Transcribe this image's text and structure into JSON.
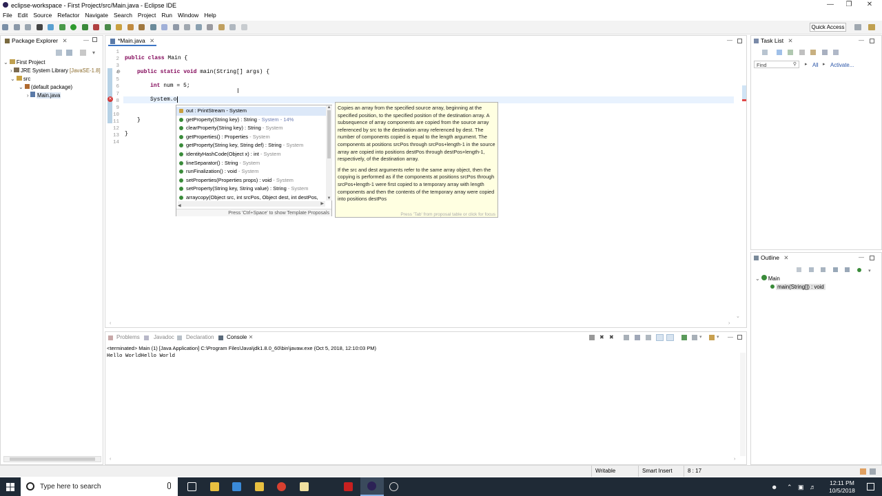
{
  "window": {
    "title": "eclipse-workspace - First Project/src/Main.java - Eclipse IDE"
  },
  "menu": [
    "File",
    "Edit",
    "Source",
    "Refactor",
    "Navigate",
    "Search",
    "Project",
    "Run",
    "Window",
    "Help"
  ],
  "quick_access": "Quick Access",
  "package_explorer": {
    "title": "Package Explorer",
    "tree": [
      "First Project",
      "JRE System Library",
      "[JavaSE-1.8]",
      "src",
      "(default package)",
      "Main.java"
    ]
  },
  "editor": {
    "tab": "*Main.java",
    "line_numbers": [
      "1",
      "2",
      "3",
      "4",
      "5",
      "6",
      "7",
      "8",
      "9",
      "10",
      "11",
      "12",
      "13",
      "14"
    ],
    "code": {
      "l2a": "public class",
      "l2b": " Main {",
      "l4a": "public static void",
      "l4b": " main(String[] args) {",
      "l6a": "int",
      "l6b": " num = 5;",
      "l8": "System.o",
      "l11": "}",
      "l13": "}"
    }
  },
  "autocomplete": {
    "items": [
      {
        "name": "out : PrintStream - System",
        "type": ""
      },
      {
        "name": "getProperty(String key) : String",
        "type": " - System - 14%"
      },
      {
        "name": "clearProperty(String key) : String",
        "type": " - System"
      },
      {
        "name": "getProperties() : Properties",
        "type": " - System"
      },
      {
        "name": "getProperty(String key, String def) : String",
        "type": " - System"
      },
      {
        "name": "identityHashCode(Object x) : int",
        "type": " - System"
      },
      {
        "name": "lineSeparator() : String",
        "type": " - System"
      },
      {
        "name": "runFinalization() : void",
        "type": " - System"
      },
      {
        "name": "setProperties(Properties props) : void",
        "type": " - System"
      },
      {
        "name": "setProperty(String key, String value) : String",
        "type": " - System"
      },
      {
        "name": "arraycopy(Object src, int srcPos, Object dest, int destPos,",
        "type": ""
      }
    ],
    "footer": "Press 'Ctrl+Space' to show Template Proposals"
  },
  "javadoc": {
    "p1": "Copies an array from the specified source array, beginning at the specified position, to the specified position of the destination array. A subsequence of array components are copied from the source array referenced by src to the destination array referenced by dest. The number of components copied is equal to the length argument. The components at positions srcPos through srcPos+length-1 in the source array are copied into positions destPos through destPos+length-1, respectively, of the destination array.",
    "p2": "If the src and dest arguments refer to the same array object, then the copying is performed as if the components at positions srcPos through srcPos+length-1 were first copied to a temporary array with length components and then the contents of the temporary array were copied into positions destPos",
    "footer": "Press 'Tab' from proposal table or click for focus"
  },
  "task_list": {
    "title": "Task List",
    "find_placeholder": "Find",
    "all": "All",
    "activate": "Activate..."
  },
  "outline": {
    "title": "Outline",
    "class": "Main",
    "method": "main(String[]) : void"
  },
  "bottom_tabs": [
    "Problems",
    "Javadoc",
    "Declaration",
    "Console"
  ],
  "console": {
    "terminated": "<terminated> Main (1) [Java Application] C:\\Program Files\\Java\\jdk1.8.0_60\\bin\\javaw.exe (Oct 5, 2018, 12:10:03 PM)",
    "output": "Hello WorldHello World"
  },
  "status": {
    "writable": "Writable",
    "insert": "Smart Insert",
    "position": "8 : 17"
  },
  "taskbar": {
    "search": "Type here to search",
    "time": "12:11 PM",
    "date": "10/5/2018"
  }
}
